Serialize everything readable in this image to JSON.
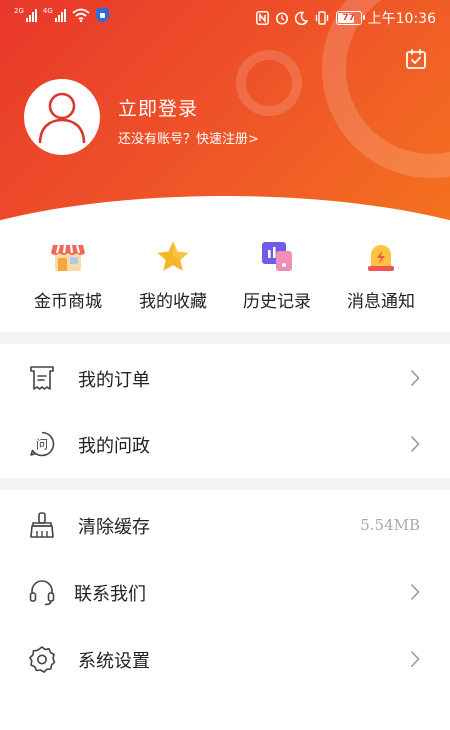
{
  "status_bar": {
    "signal_1_tag": "2G",
    "signal_2_tag": "4G",
    "battery_level": "77",
    "time": "上午10:36"
  },
  "profile": {
    "login_title": "立即登录",
    "register_prompt": "还没有账号？快速注册>"
  },
  "quick_actions": [
    {
      "label": "金币商城",
      "icon": "shop-icon"
    },
    {
      "label": "我的收藏",
      "icon": "star-icon"
    },
    {
      "label": "历史记录",
      "icon": "history-icon"
    },
    {
      "label": "消息通知",
      "icon": "bell-icon"
    }
  ],
  "menu_group_1": [
    {
      "label": "我的订单",
      "icon": "receipt-icon"
    },
    {
      "label": "我的问政",
      "icon": "question-chat-icon"
    }
  ],
  "menu_group_2": [
    {
      "label": "清除缓存",
      "icon": "broom-icon",
      "value": "5.54MB"
    },
    {
      "label": "联系我们",
      "icon": "headset-icon"
    },
    {
      "label": "系统设置",
      "icon": "gear-icon"
    }
  ],
  "colors": {
    "header_gradient_start": "#e8372b",
    "header_gradient_end": "#f4731f",
    "section_gap": "#f3f3f3",
    "chevron": "#999999"
  }
}
